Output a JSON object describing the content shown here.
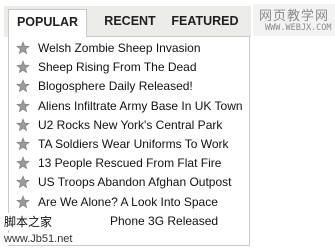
{
  "tabs": {
    "popular": "POPULAR",
    "recent": "RECENT",
    "featured": "FEATURED"
  },
  "items": [
    "Welsh Zombie Sheep Invasion",
    "Sheep Rising From The Dead",
    "Blogosphere Daily Released!",
    "Aliens Infiltrate Army Base In UK Town",
    "U2 Rocks New York's Central Park",
    "TA Soldiers Wear Uniforms To Work",
    "13 People Rescued From Flat Fire",
    "US Troops Abandon Afghan Outpost",
    "Are We Alone? A Look Into Space",
    "Phone 3G Released"
  ],
  "watermarks": {
    "top_site_name": "网页教学网",
    "top_site_url": "WWW.WEBJX.COM",
    "bottom_cn": "脚本之家",
    "bottom_url": "www.Jb51.net"
  },
  "icons": {
    "item_icon": "star-icon"
  },
  "colors": {
    "tabbar_bg": "#ebebe7",
    "border": "#c9c9c5",
    "text": "#111111"
  }
}
